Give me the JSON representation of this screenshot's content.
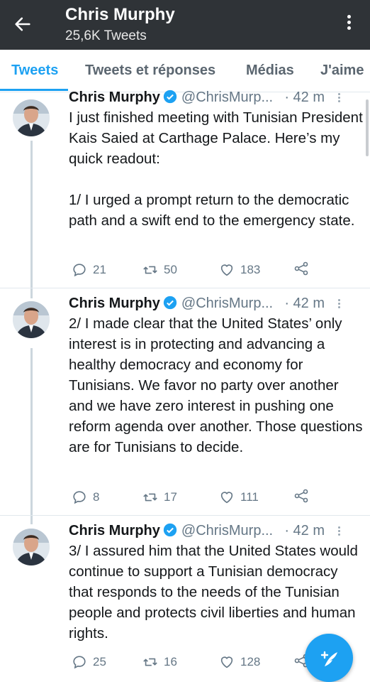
{
  "header": {
    "title": "Chris Murphy",
    "subtitle": "25,6K Tweets"
  },
  "tabs": [
    {
      "label": "Tweets",
      "active": true
    },
    {
      "label": "Tweets et réponses",
      "active": false
    },
    {
      "label": "Médias",
      "active": false
    },
    {
      "label": "J'aime",
      "active": false
    }
  ],
  "tweets": [
    {
      "name": "Chris Murphy",
      "handle": "@ChrisMurp...",
      "time": "· 42 m",
      "text": "I just finished meeting with Tunisian President Kais Saied at Carthage Palace. Here’s my quick readout:\n\n1/ I urged a prompt return to the democratic path and a swift end to the emergency state.",
      "replies": "21",
      "retweets": "50",
      "likes": "183"
    },
    {
      "name": "Chris Murphy",
      "handle": "@ChrisMurp...",
      "time": "· 42 m",
      "text": "2/ I made clear that the United States’ only interest is in protecting and advancing a healthy democracy and economy for Tunisians. We favor no party over another and we have zero interest in pushing one reform agenda over another. Those questions are for Tunisians to decide.",
      "replies": "8",
      "retweets": "17",
      "likes": "111"
    },
    {
      "name": "Chris Murphy",
      "handle": "@ChrisMurp...",
      "time": "· 42 m",
      "text": "3/ I assured him that the United States would continue to support a Tunisian democracy that responds to the needs of the Tunisian people and protects civil liberties and human rights.",
      "replies": "25",
      "retweets": "16",
      "likes": "128"
    }
  ],
  "colors": {
    "accent": "#1da1f2",
    "header_bg": "#2f3337",
    "muted": "#657786"
  },
  "icons": [
    "back-arrow-icon",
    "more-vertical-icon",
    "verified-badge-icon",
    "reply-icon",
    "retweet-icon",
    "like-icon",
    "share-icon",
    "compose-icon"
  ]
}
